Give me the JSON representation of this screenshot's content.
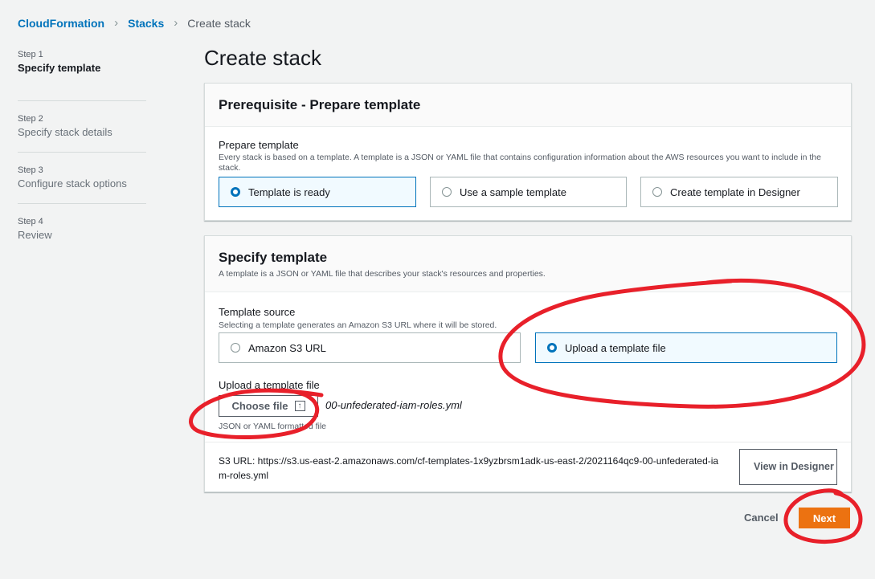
{
  "breadcrumb": {
    "items": [
      "CloudFormation",
      "Stacks"
    ],
    "current": "Create stack"
  },
  "steps": [
    {
      "num": "Step 1",
      "title": "Specify template",
      "active": true
    },
    {
      "num": "Step 2",
      "title": "Specify stack details"
    },
    {
      "num": "Step 3",
      "title": "Configure stack options"
    },
    {
      "num": "Step 4",
      "title": "Review"
    }
  ],
  "page_title": "Create stack",
  "prerequisite": {
    "title": "Prerequisite - Prepare template",
    "label": "Prepare template",
    "description": "Every stack is based on a template. A template is a JSON or YAML file that contains configuration information about the AWS resources you want to include in the stack.",
    "options": [
      {
        "label": "Template is ready",
        "selected": true
      },
      {
        "label": "Use a sample template",
        "selected": false
      },
      {
        "label": "Create template in Designer",
        "selected": false
      }
    ]
  },
  "specify": {
    "title": "Specify template",
    "subtitle": "A template is a JSON or YAML file that describes your stack's resources and properties.",
    "source_label": "Template source",
    "source_desc": "Selecting a template generates an Amazon S3 URL where it will be stored.",
    "source_options": [
      {
        "label": "Amazon S3 URL",
        "selected": false
      },
      {
        "label": "Upload a template file",
        "selected": true
      }
    ],
    "upload_label": "Upload a template file",
    "choose_file_label": "Choose file",
    "file_name": "00-unfederated-iam-roles.yml",
    "file_hint": "JSON or YAML formatted file",
    "s3_url_text": "S3 URL:  https://s3.us-east-2.amazonaws.com/cf-templates-1x9yzbrsm1adk-us-east-2/2021164qc9-00-unfederated-iam-roles.yml",
    "view_designer_label": "View in Designer"
  },
  "footer": {
    "cancel_label": "Cancel",
    "next_label": "Next"
  },
  "colors": {
    "accent": "#0073bb",
    "primary_button": "#ec7211",
    "annotation": "#e8202a"
  }
}
